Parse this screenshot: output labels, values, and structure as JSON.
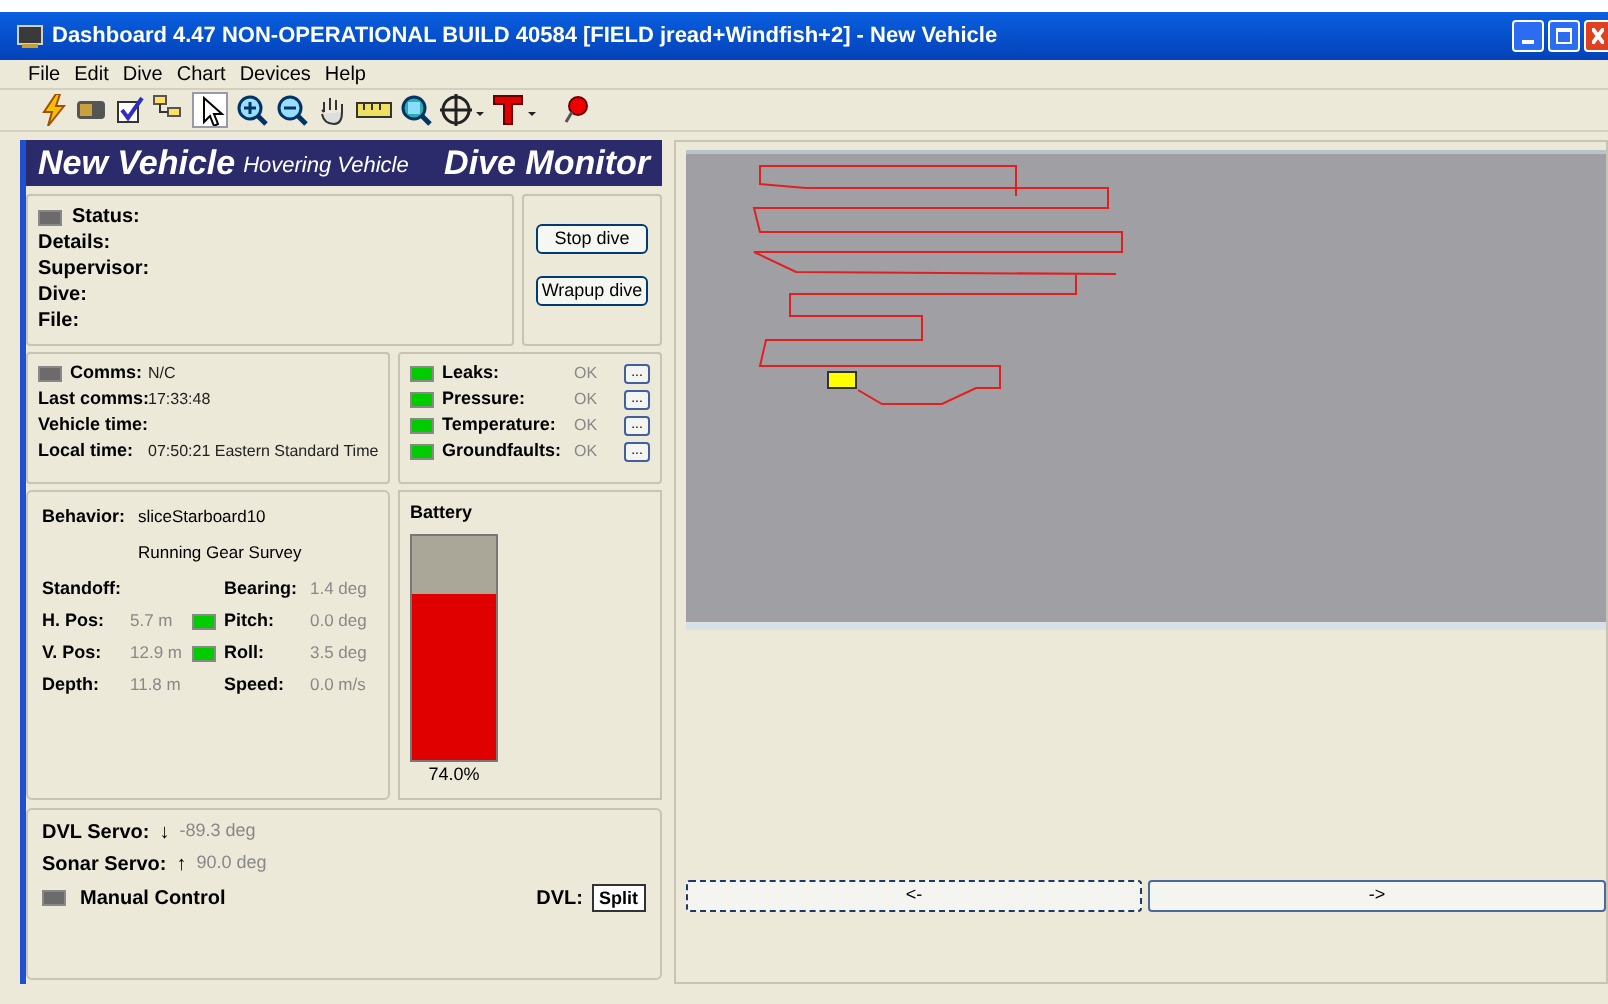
{
  "window": {
    "title": "Dashboard 4.47 NON-OPERATIONAL BUILD 40584 [FIELD jread+Windfish+2] - New Vehicle"
  },
  "menu": [
    "File",
    "Edit",
    "Dive",
    "Chart",
    "Devices",
    "Help"
  ],
  "header": {
    "vehicle": "New Vehicle",
    "vehicle_type": "Hovering Vehicle",
    "mode": "Dive Monitor"
  },
  "status": {
    "indicator_on": false,
    "fields": [
      {
        "label": "Status:"
      },
      {
        "label": "Details:"
      },
      {
        "label": "Supervisor:"
      },
      {
        "label": "Dive:"
      },
      {
        "label": "File:"
      }
    ],
    "buttons": [
      "Stop dive",
      "Wrapup dive"
    ]
  },
  "comms": {
    "indicator_on": false,
    "rows": [
      {
        "label": "Comms:",
        "value": "N/C"
      },
      {
        "label": "Last comms:",
        "value": "17:33:48"
      },
      {
        "label": "Vehicle time:"
      },
      {
        "label": "Local time:",
        "value": "07:50:21 Eastern Standard Time"
      }
    ]
  },
  "alarms": [
    {
      "label": "Leaks:",
      "value": "OK",
      "color": "#00cc00",
      "button": "..."
    },
    {
      "label": "Pressure:",
      "value": "OK",
      "color": "#00cc00",
      "button": "..."
    },
    {
      "label": "Temperature:",
      "value": "OK",
      "color": "#00cc00",
      "button": "..."
    },
    {
      "label": "Groundfaults:",
      "value": "OK",
      "color": "#00cc00",
      "button": "..."
    }
  ],
  "behavior": {
    "label": "Behavior:",
    "value": "sliceStarboard10",
    "description": "Running Gear Survey",
    "left": [
      {
        "label": "Standoff:"
      },
      {
        "label": "H. Pos:",
        "value": "5.7 m",
        "color": "#00cc00"
      },
      {
        "label": "V. Pos:",
        "value": "12.9 m",
        "color": "#00cc00"
      },
      {
        "label": "Depth:",
        "value": "11.8 m"
      }
    ],
    "right": [
      {
        "label": "Bearing:",
        "value": "1.4 deg"
      },
      {
        "label": "Pitch:",
        "value": "0.0 deg"
      },
      {
        "label": "Roll:",
        "value": "3.5 deg"
      },
      {
        "label": "Speed:",
        "value": "0.0 m/s"
      }
    ]
  },
  "battery": {
    "title": "Battery",
    "level": 0.74,
    "reading": "74.0%"
  },
  "servos": [
    {
      "label": "DVL Servo:",
      "arrow": "↓",
      "value": "-89.3 deg"
    },
    {
      "label": "Sonar Servo:",
      "arrow": "↑",
      "value": "90.0 deg"
    }
  ],
  "manual_control": {
    "label": "Manual Control",
    "on": false
  },
  "dvl": {
    "label": "DVL:",
    "button": "Split"
  },
  "nav_buttons": [
    {
      "label": "<-",
      "focused": true
    },
    {
      "label": "->",
      "focused": false
    }
  ]
}
